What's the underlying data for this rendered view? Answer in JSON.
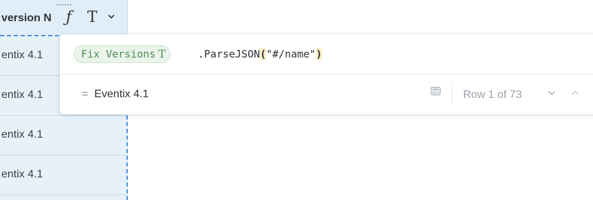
{
  "column": {
    "header_title": "version N",
    "formula_symbol": "ƒ",
    "type_symbol": "T",
    "cells": [
      "entix 4.1",
      "entix 4.1",
      "entix 4.1",
      "entix 4.1"
    ]
  },
  "formula": {
    "field_pill": "Fix Versions",
    "field_type": "T",
    "method": ".ParseJSON",
    "open_paren": "(",
    "argument": "\"#/name\"",
    "close_paren": ")"
  },
  "result": {
    "equals": "=",
    "value": "Eventix 4.1",
    "row_counter": "Row 1 of 73"
  },
  "colors": {
    "column_bg": "#e6f1f8",
    "selection_dash": "#4d8fdc",
    "pill_green": "#4f8a55"
  },
  "icons": [
    "drag-handle-icon",
    "chevron-down-icon",
    "copy-icon",
    "chevron-up-icon"
  ]
}
